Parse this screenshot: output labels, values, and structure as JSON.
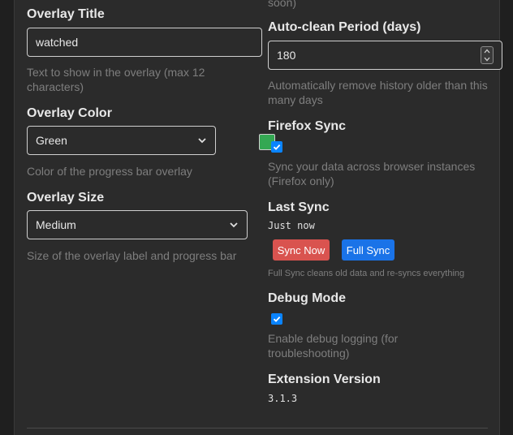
{
  "left": {
    "overlay_title": {
      "label": "Overlay Title",
      "value": "watched",
      "help": "Text to show in the overlay (max 12 characters)"
    },
    "overlay_color": {
      "label": "Overlay Color",
      "value": "Green",
      "swatch": "#34a853",
      "help": "Color of the progress bar overlay"
    },
    "overlay_size": {
      "label": "Overlay Size",
      "value": "Medium",
      "help": "Size of the overlay label and progress bar"
    }
  },
  "right": {
    "top_fragment": "soon)",
    "auto_clean": {
      "label": "Auto-clean Period (days)",
      "value": "180",
      "help": "Automatically remove history older than this many days"
    },
    "firefox_sync": {
      "label": "Firefox Sync",
      "checked": true,
      "help": "Sync your data across browser instances (Firefox only)"
    },
    "last_sync": {
      "label": "Last Sync",
      "value": "Just now",
      "sync_now_label": "Sync Now",
      "full_sync_label": "Full Sync",
      "help": "Full Sync cleans old data and re-syncs everything"
    },
    "debug_mode": {
      "label": "Debug Mode",
      "checked": true,
      "help": "Enable debug logging (for troubleshooting)"
    },
    "extension_version": {
      "label": "Extension Version",
      "value": "3.1.3"
    }
  },
  "colors": {
    "background": "#2b2b2b",
    "checkbox": "#0a84ff",
    "sync_now_button": "#d9534f",
    "full_sync_button": "#1a73e8"
  }
}
